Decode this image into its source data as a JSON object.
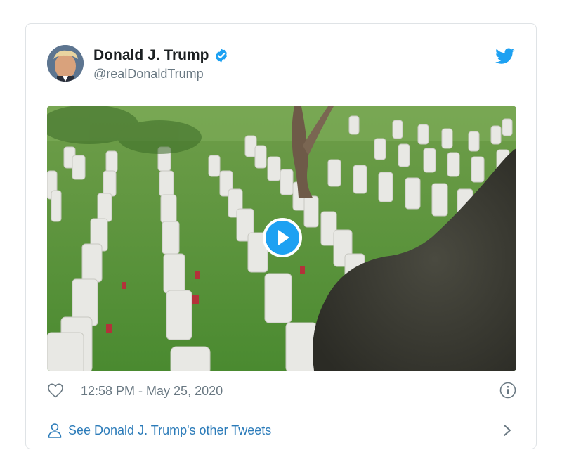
{
  "tweet": {
    "display_name": "Donald J. Trump",
    "handle": "@realDonaldTrump",
    "timestamp": "12:58 PM - May 25, 2020",
    "footer_link": "See Donald J. Trump's other Tweets"
  },
  "icons": {
    "verified": "verified-badge-icon",
    "brand": "twitter-bird-icon",
    "like": "heart-outline-icon",
    "info": "info-circle-icon",
    "person": "person-outline-icon",
    "chevron": "chevron-right-icon",
    "play": "play-icon"
  },
  "colors": {
    "accent": "#1da1f2",
    "link": "#2b7bb9",
    "muted_text": "#697882",
    "primary_text": "#1c2022",
    "border": "#dfe3e6"
  }
}
